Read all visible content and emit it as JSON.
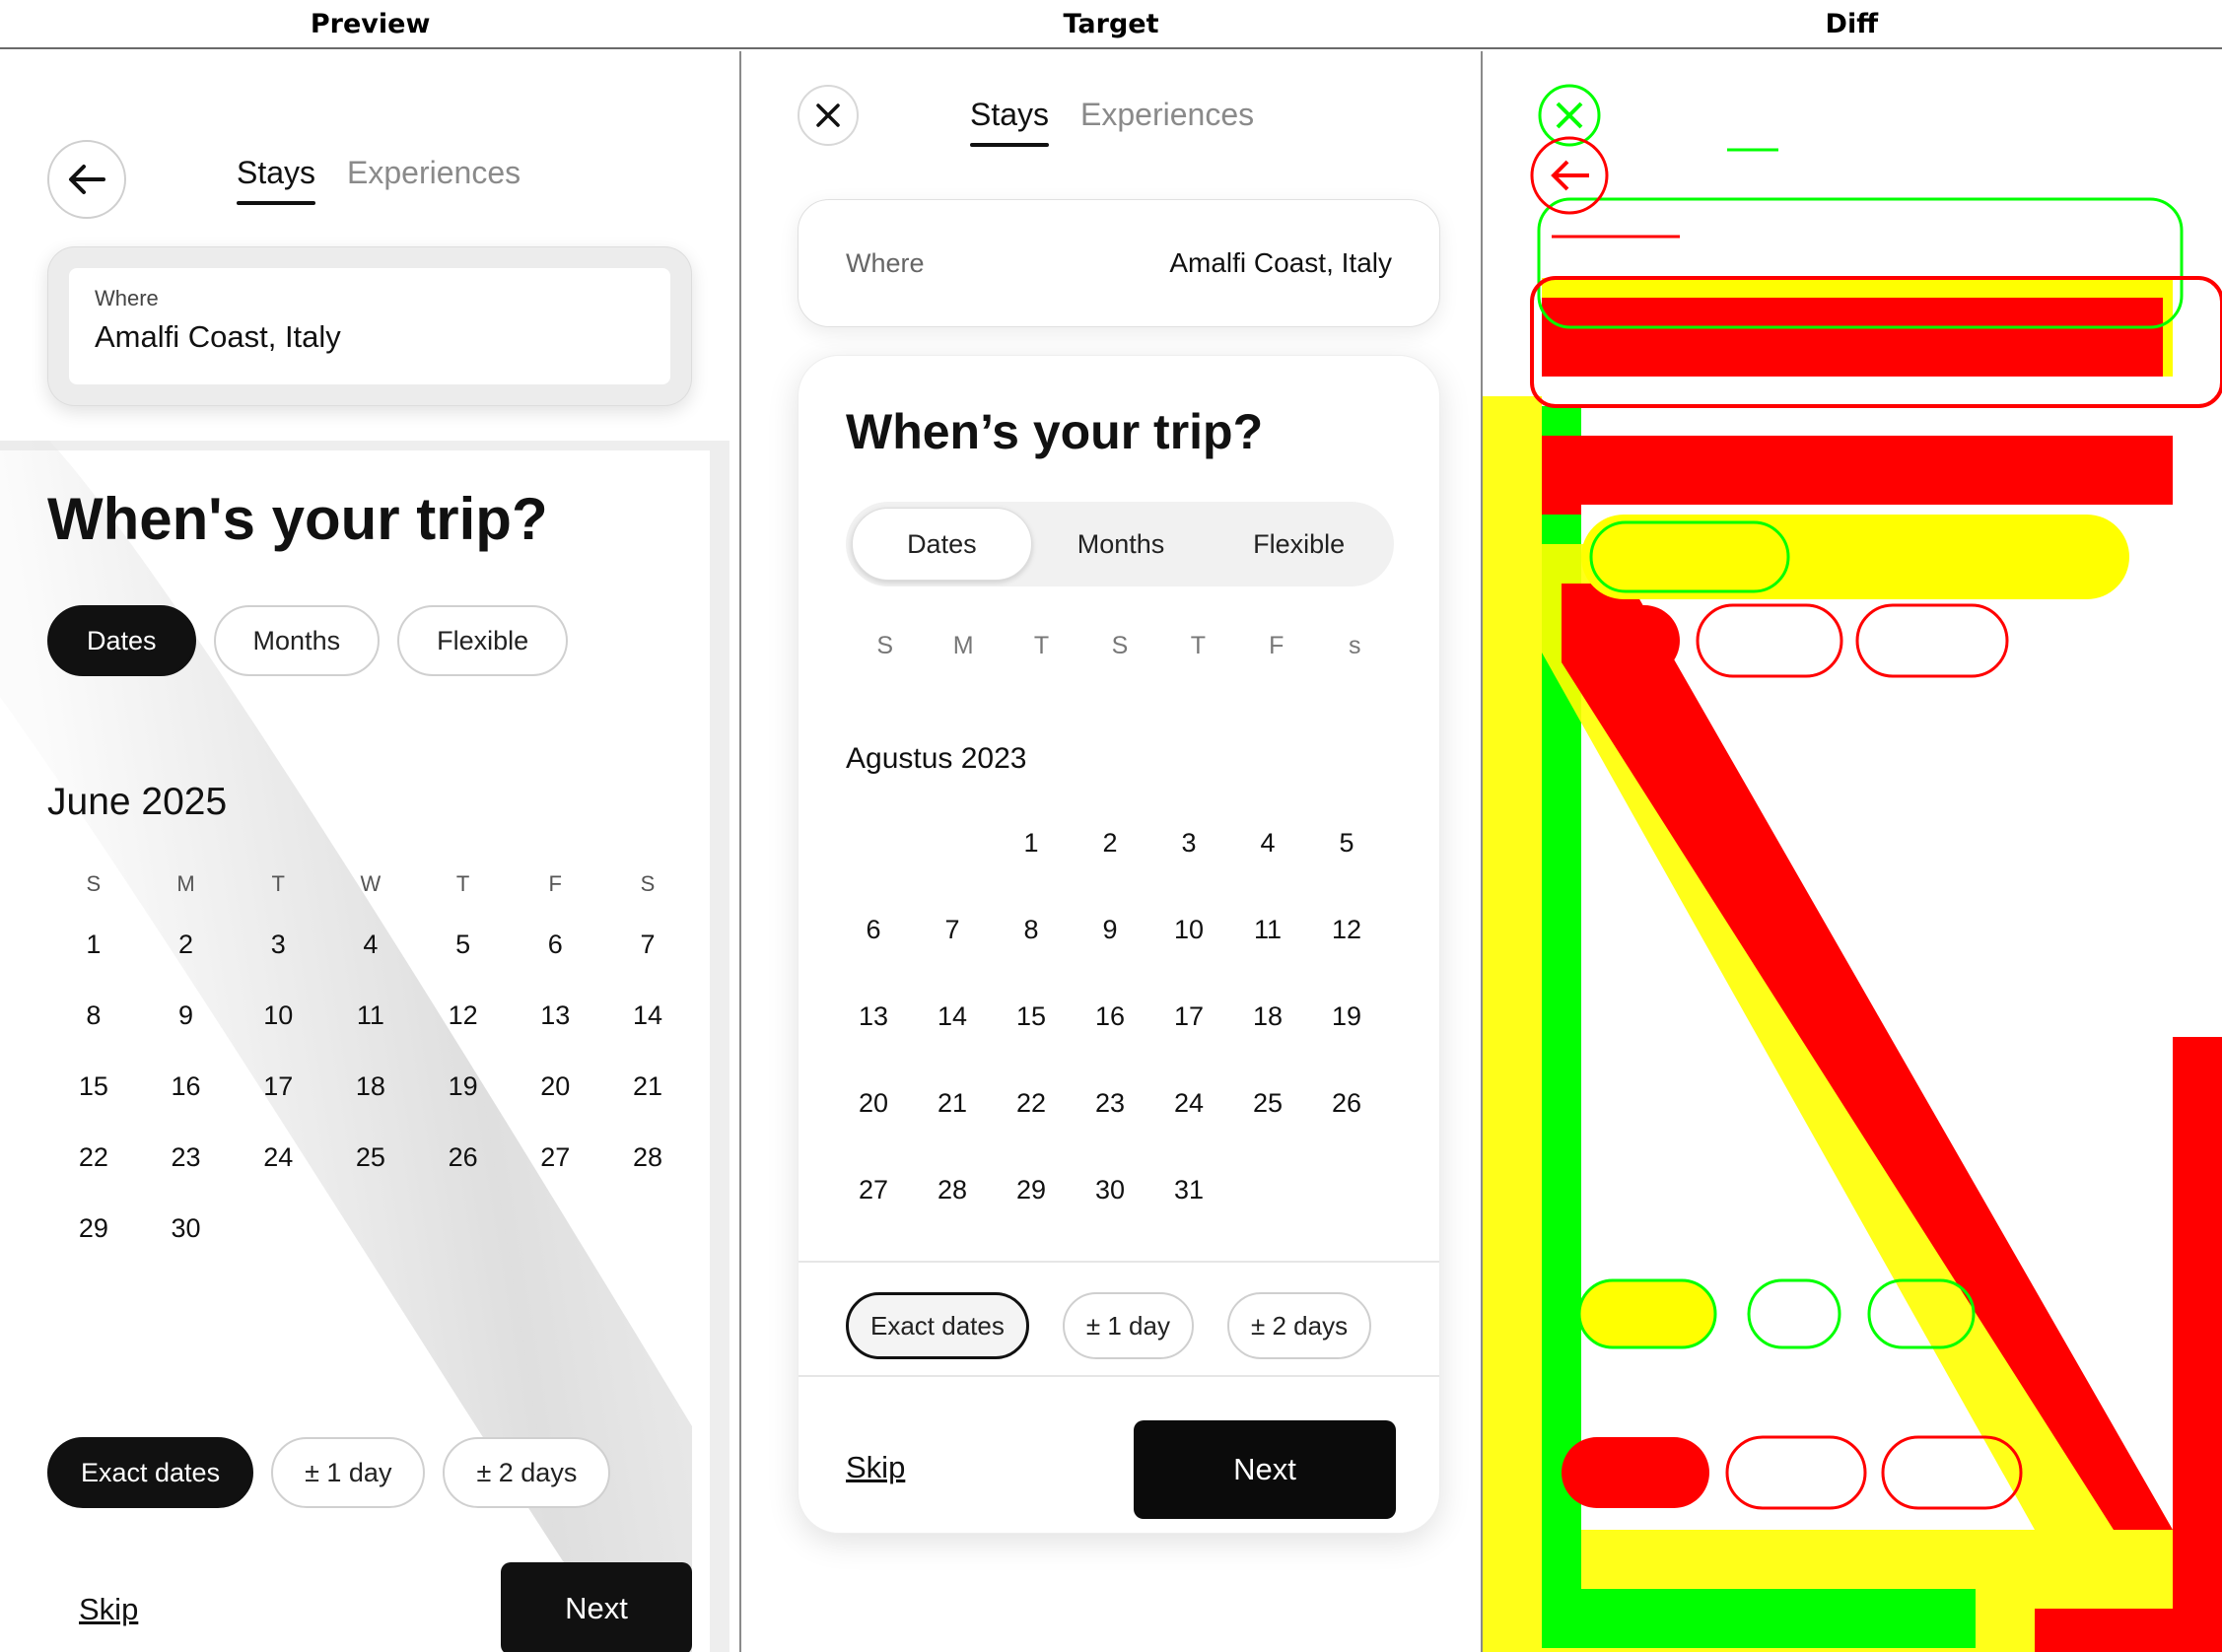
{
  "headers": {
    "preview": "Preview",
    "target": "Target",
    "diff": "Diff"
  },
  "preview": {
    "tabs": [
      "Stays",
      "Experiences"
    ],
    "where_label": "Where",
    "where_value": "Amalfi Coast, Italy",
    "title": "When's your trip?",
    "segments": [
      "Dates",
      "Months",
      "Flexible"
    ],
    "month": "June 2025",
    "weekdays": [
      "S",
      "M",
      "T",
      "W",
      "T",
      "F",
      "S"
    ],
    "weeks": [
      [
        "1",
        "2",
        "3",
        "4",
        "5",
        "6",
        "7"
      ],
      [
        "8",
        "9",
        "10",
        "11",
        "12",
        "13",
        "14"
      ],
      [
        "15",
        "16",
        "17",
        "18",
        "19",
        "20",
        "21"
      ],
      [
        "22",
        "23",
        "24",
        "25",
        "26",
        "27",
        "28"
      ],
      [
        "29",
        "30",
        "",
        "",
        "",
        "",
        ""
      ]
    ],
    "flex_options": [
      "Exact dates",
      "± 1 day",
      "± 2 days"
    ],
    "skip": "Skip",
    "next": "Next"
  },
  "target": {
    "tabs": [
      "Stays",
      "Experiences"
    ],
    "where_label": "Where",
    "where_value": "Amalfi Coast, Italy",
    "title": "When’s your trip?",
    "segments": [
      "Dates",
      "Months",
      "Flexible"
    ],
    "weekdays": [
      "S",
      "M",
      "T",
      "S",
      "T",
      "F",
      "s"
    ],
    "month": "Agustus 2023",
    "weeks": [
      [
        "",
        "",
        "1",
        "2",
        "3",
        "4",
        "5"
      ],
      [
        "6",
        "7",
        "8",
        "9",
        "10",
        "11",
        "12"
      ],
      [
        "13",
        "14",
        "15",
        "16",
        "17",
        "18",
        "19"
      ],
      [
        "20",
        "21",
        "22",
        "23",
        "24",
        "25",
        "26"
      ],
      [
        "27",
        "28",
        "29",
        "30",
        "31",
        "",
        ""
      ]
    ],
    "flex_options": [
      "Exact dates",
      "± 1 day",
      "± 2 days"
    ],
    "skip": "Skip",
    "next": "Next"
  },
  "colors": {
    "diff_red": "#ff0000",
    "diff_green": "#00ff00",
    "diff_yellow": "#ffff00"
  }
}
